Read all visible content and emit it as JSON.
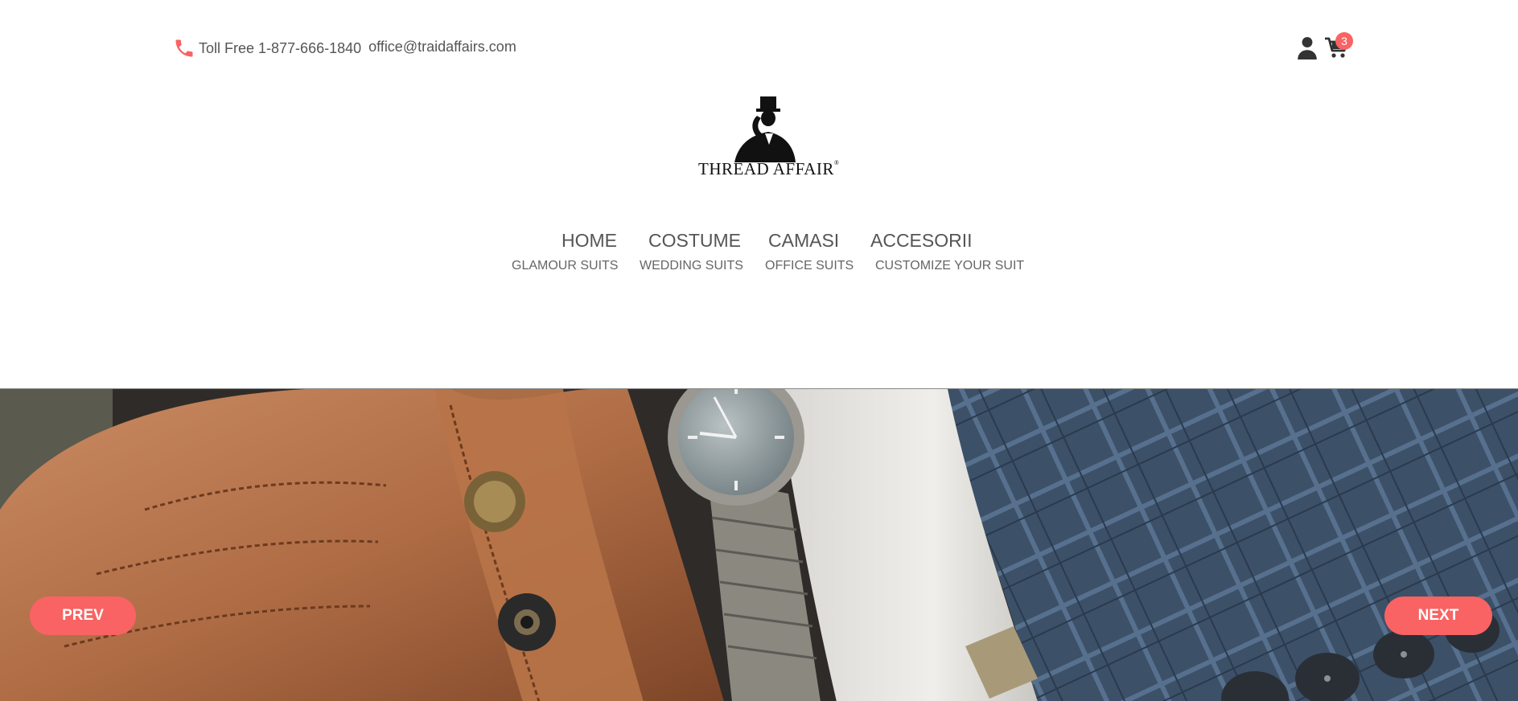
{
  "contact": {
    "phone": "Toll Free 1-877-666-1840",
    "email": "office@traidaffairs.com"
  },
  "cart": {
    "count": "3"
  },
  "logo": {
    "text": "THREAD AFFAIR",
    "mark": "®"
  },
  "nav": {
    "main": [
      "HOME",
      "COSTUME",
      "CAMASI",
      "ACCESORII"
    ],
    "sub": [
      "GLAMOUR SUITS",
      "WEDDING SUITS",
      "OFFICE SUITS",
      "CUSTOMIZE YOUR SUIT"
    ]
  },
  "slider": {
    "prev_label": "PREV",
    "next_label": "NEXT"
  },
  "colors": {
    "accent": "#f96363",
    "text": "#555555"
  }
}
